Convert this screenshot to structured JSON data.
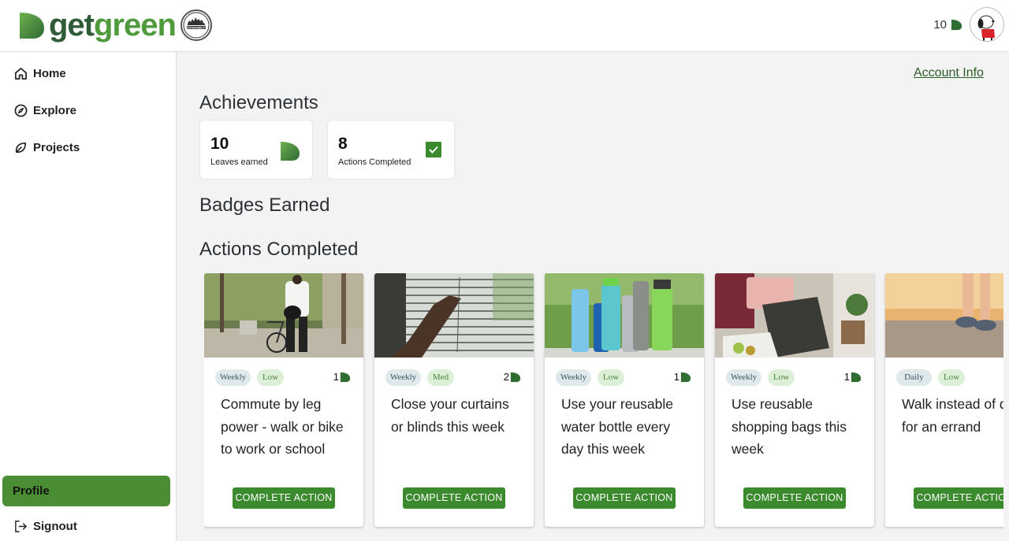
{
  "header": {
    "logo_get": "get",
    "logo_green": "green",
    "leaf_count": "10",
    "seal_text": "SUSTAINABILITY"
  },
  "sidebar": {
    "items": [
      {
        "label": "Home",
        "icon": "home-icon"
      },
      {
        "label": "Explore",
        "icon": "compass-icon"
      },
      {
        "label": "Projects",
        "icon": "leaf-icon"
      }
    ],
    "profile_label": "Profile",
    "signout_label": "Signout"
  },
  "main": {
    "account_link": "Account Info",
    "achievements_title": "Achievements",
    "stats": [
      {
        "value": "10",
        "label": "Leaves earned",
        "icon": "leaf-icon"
      },
      {
        "value": "8",
        "label": "Actions Completed",
        "icon": "check-icon"
      }
    ],
    "badges_title": "Badges Earned",
    "actions_title": "Actions Completed",
    "cards": [
      {
        "frequency": "Weekly",
        "level": "Low",
        "points": "1",
        "title": "Commute by leg power - walk or bike to work or school",
        "button": "COMPLETE ACTION"
      },
      {
        "frequency": "Weekly",
        "level": "Med",
        "points": "2",
        "title": "Close your curtains or blinds this week",
        "button": "COMPLETE ACTION"
      },
      {
        "frequency": "Weekly",
        "level": "Low",
        "points": "1",
        "title": "Use your reusable water bottle every day this week",
        "button": "COMPLETE ACTION"
      },
      {
        "frequency": "Weekly",
        "level": "Low",
        "points": "1",
        "title": "Use reusable shopping bags this week",
        "button": "COMPLETE ACTION"
      },
      {
        "frequency": "Daily",
        "level": "Low",
        "points": "",
        "title": "Walk instead of drive for an errand",
        "button": "COMPLETE ACTION"
      }
    ]
  },
  "colors": {
    "brand_dark": "#2f5b38",
    "brand_light": "#4e9a3c",
    "button_green": "#3c8a2e",
    "profile_green": "#4b8d34"
  }
}
